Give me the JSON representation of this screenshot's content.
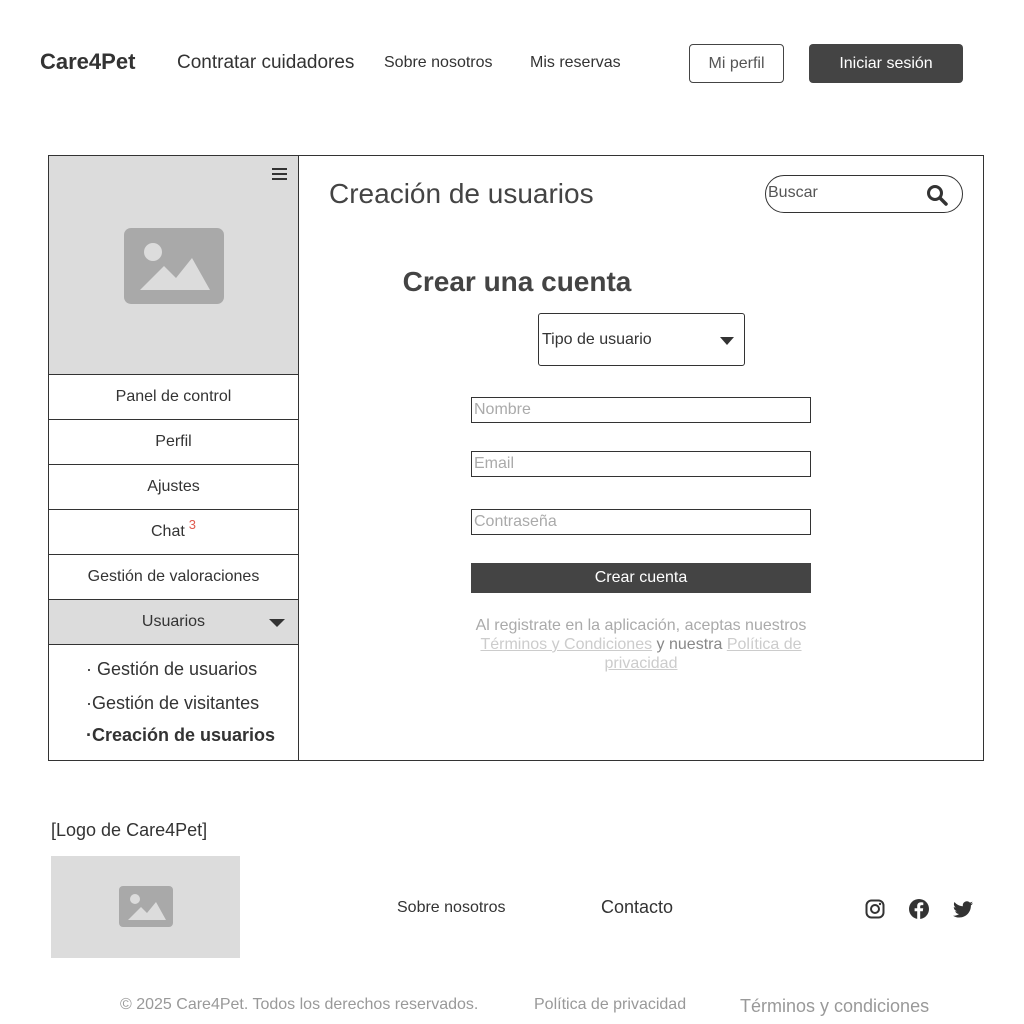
{
  "header": {
    "brand": "Care4Pet",
    "nav": [
      "Contratar cuidadores",
      "Sobre nosotros",
      "Mis reservas"
    ],
    "profile_button": "Mi perfil",
    "login_button": "Iniciar sesión"
  },
  "sidebar": {
    "items": [
      {
        "label": "Panel de control"
      },
      {
        "label": "Perfil"
      },
      {
        "label": "Ajustes"
      },
      {
        "label": "Chat",
        "badge": "3"
      },
      {
        "label": "Gestión de valoraciones"
      },
      {
        "label": "Usuarios"
      }
    ],
    "submenu": [
      "· Gestión de usuarios",
      "·Gestión de visitantes",
      "·Creación de usuarios"
    ]
  },
  "main": {
    "title": "Creación de usuarios",
    "search_placeholder": "Buscar",
    "form": {
      "heading": "Crear una cuenta",
      "user_type": "Tipo de usuario",
      "name_placeholder": "Nombre",
      "email_placeholder": "Email",
      "password_placeholder": "Contraseña",
      "submit": "Crear cuenta",
      "legal_prefix": "Al registrate en la aplicación, aceptas nuestros",
      "terms_link": "Términos y Condiciones",
      "legal_mid": "y nuestra",
      "privacy_link": "Política de privacidad"
    }
  },
  "footer": {
    "logo_label": "[Logo de Care4Pet]",
    "about": "Sobre nosotros",
    "contact": "Contacto",
    "social_icons": [
      "instagram-icon",
      "facebook-icon",
      "twitter-icon"
    ],
    "copyright": "© 2025 Care4Pet. Todos los derechos reservados.",
    "privacy": "Política de privacidad",
    "terms": "Términos y condiciones"
  },
  "colors": {
    "dark_button": "#444444",
    "placeholder_gray": "#dcdcdc",
    "badge_red": "#e05a4f"
  }
}
